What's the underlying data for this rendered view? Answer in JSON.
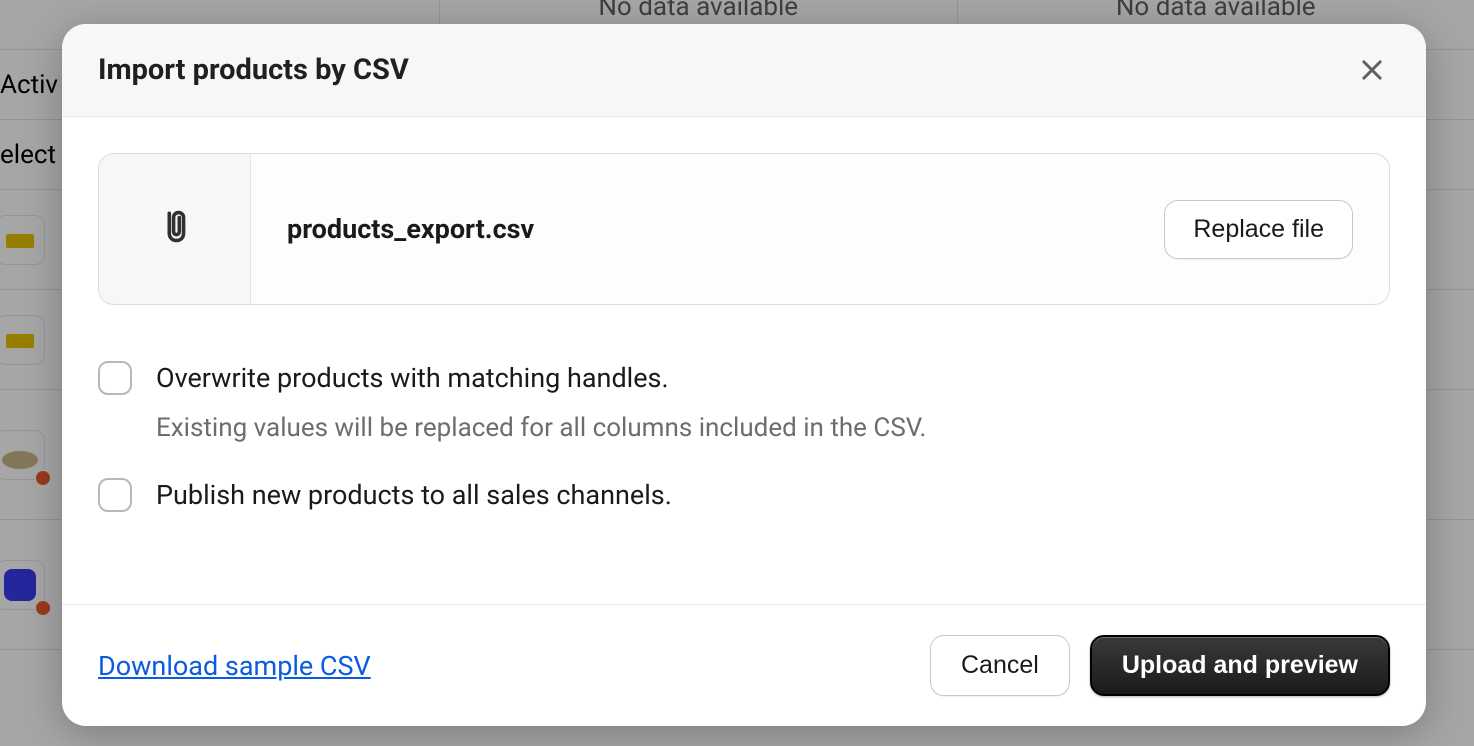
{
  "background": {
    "no_data": "No data available",
    "row_active": "Activ",
    "row_select": "elect"
  },
  "modal": {
    "title": "Import products by CSV",
    "file_name": "products_export.csv",
    "replace_label": "Replace file",
    "options": {
      "overwrite_label": "Overwrite products with matching handles.",
      "overwrite_desc": "Existing values will be replaced for all columns included in the CSV.",
      "publish_label": "Publish new products to all sales channels."
    },
    "footer": {
      "download_link": "Download sample CSV",
      "cancel_label": "Cancel",
      "upload_label": "Upload and preview"
    }
  }
}
